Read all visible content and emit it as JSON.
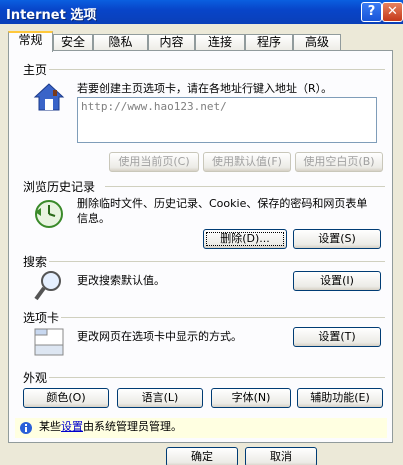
{
  "window": {
    "title": "Internet 选项",
    "help": "?",
    "close": "✕"
  },
  "tabs": [
    "常规",
    "安全",
    "隐私",
    "内容",
    "连接",
    "程序",
    "高级"
  ],
  "homepage": {
    "title": "主页",
    "desc": "若要创建主页选项卡，请在各地址行键入地址（R）。",
    "value": "http://www.hao123.net/",
    "buttons": [
      "使用当前页(C)",
      "使用默认值(F)",
      "使用空白页(B)"
    ]
  },
  "history": {
    "title": "浏览历史记录",
    "desc": "删除临时文件、历史记录、Cookie、保存的密码和网页表单信息。",
    "delete": "删除(D)...",
    "settings": "设置(S)"
  },
  "search": {
    "title": "搜索",
    "desc": "更改搜索默认值。",
    "settings": "设置(I)"
  },
  "tabs_group": {
    "title": "选项卡",
    "desc": "更改网页在选项卡中显示的方式。",
    "settings": "设置(T)"
  },
  "appearance": {
    "title": "外观",
    "buttons": [
      "颜色(O)",
      "语言(L)",
      "字体(N)",
      "辅助功能(E)"
    ]
  },
  "infobar": {
    "before": "某些",
    "link": "设置",
    "after": "由系统管理员管理。"
  },
  "footer": {
    "ok": "确定",
    "cancel": "取消"
  },
  "colors": {
    "titlebar": "#0845c9",
    "dialog": "#ece9d8",
    "active_tab_accent": "#ffc83c"
  }
}
